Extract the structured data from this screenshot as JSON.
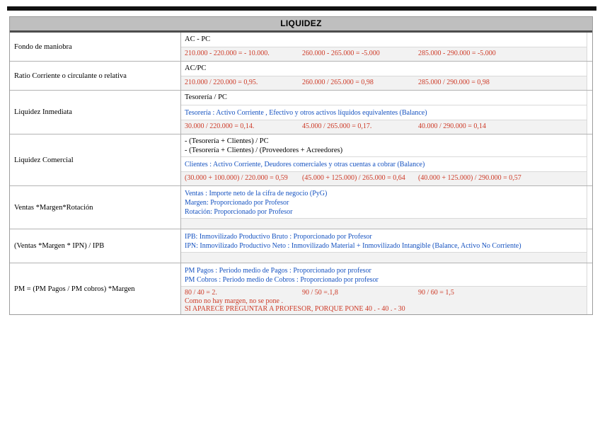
{
  "colors": {
    "header_bg": "#bfbfbf",
    "result_red": "#cd3a27",
    "note_blue": "#1552c0",
    "shade_bg": "#f2f2f2"
  },
  "table": {
    "header": "LIQUIDEZ",
    "rows": [
      {
        "label": "Fondo de maniobra",
        "sublines": [
          {
            "type": "formula",
            "lines": [
              "AC - PC"
            ]
          },
          {
            "type": "result3",
            "cols": [
              "210.000 - 220.000 = - 10.000.",
              "260.000 - 265.000 = -5.000",
              "285.000 - 290.000 = -5.000"
            ]
          }
        ]
      },
      {
        "label": "Ratio Corriente o circulante o relativa",
        "sublines": [
          {
            "type": "formula",
            "lines": [
              "AC/PC"
            ]
          },
          {
            "type": "result3",
            "cols": [
              "210.000 / 220.000 = 0,95.",
              "260.000 / 265.000 = 0,98",
              "285.000 / 290.000 = 0,98"
            ]
          }
        ]
      },
      {
        "label": "Liquidez Inmediata",
        "sublines": [
          {
            "type": "formula",
            "lines": [
              "Tesorería / PC"
            ]
          },
          {
            "type": "note",
            "lines": [
              "Tesorería : Activo Corriente , Efectivo y otros activos líquidos equivalentes (Balance)"
            ]
          },
          {
            "type": "result3",
            "cols": [
              "30.000 / 220.000 = 0,14.",
              "45.000 / 265.000 = 0,17.",
              "40.000 / 290.000 = 0,14"
            ]
          }
        ]
      },
      {
        "label": "Liquidez Comercial",
        "sublines": [
          {
            "type": "formula",
            "lines": [
              "-   (Tesorería + Clientes) / PC",
              "-   (Tesorería + Clientes) / (Proveedores + Acreedores)"
            ]
          },
          {
            "type": "note",
            "lines": [
              "Clientes : Activo Corriente, Deudores comerciales y otras cuentas a cobrar (Balance)"
            ]
          },
          {
            "type": "result3",
            "cols": [
              "(30.000 + 100.000) / 220.000 = 0,59",
              "(45.000 + 125.000) / 265.000 = 0,64",
              "(40.000 + 125.000) / 290.000 = 0,57"
            ]
          }
        ]
      },
      {
        "label": "Ventas *Margen*Rotación",
        "sublines": [
          {
            "type": "note",
            "lines": [
              "Ventas : Importe neto de la cifra de negocio (PyG)",
              "Margen: Proporcionado por Profesor",
              "Rotación: Proporcionado por Profesor"
            ]
          },
          {
            "type": "empty"
          }
        ]
      },
      {
        "label": "(Ventas  *Margen * IPN) / IPB",
        "sublines": [
          {
            "type": "note",
            "lines": [
              "IPB: Inmovilizado Productivo Bruto : Proporcionado por Profesor",
              "IPN: Inmovilizado Productivo Neto : Inmovilizado Material + Inmovilizado Intangible (Balance, Activo No Corriente)"
            ]
          },
          {
            "type": "empty"
          }
        ]
      },
      {
        "label": "PM = (PM Pagos / PM cobros) *Margen",
        "sublines": [
          {
            "type": "note",
            "lines": [
              "PM Pagos : Periodo medio de Pagos : Proporcionado por profesor",
              "PM Cobros : Periodo medio de Cobros : Proporcionado por profesor"
            ]
          },
          {
            "type": "result-block",
            "cols": [
              "80 / 40 = 2.",
              "90 / 50 =.1,8",
              "90 / 60 = 1,5"
            ],
            "lines": [
              "Como no hay margen, no se pone .",
              "SI APARECE PREGUNTAR A PROFESOR, PORQUE PONE 40 . -  40 . -  30"
            ]
          }
        ]
      }
    ]
  }
}
